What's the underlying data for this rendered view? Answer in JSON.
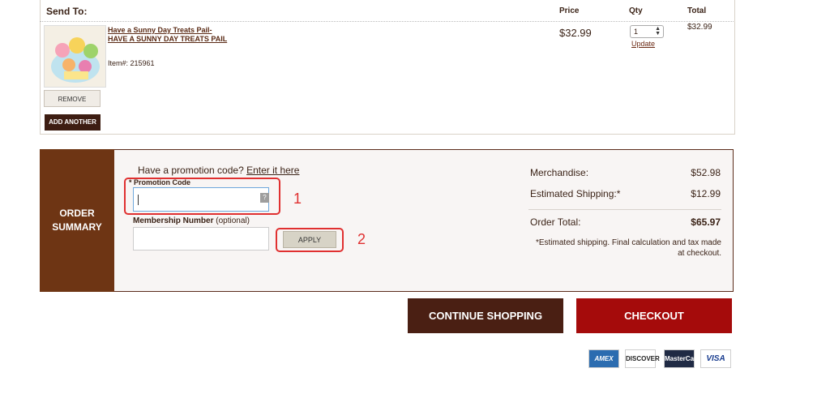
{
  "cart": {
    "send_to_label": "Send To:",
    "columns": {
      "price": "Price",
      "qty": "Qty",
      "total": "Total"
    },
    "item": {
      "name_line1": "Have a Sunny Day Treats Pail-",
      "name_line2": "HAVE A SUNNY DAY TREATS PAIL",
      "item_number": "Item#: 215961",
      "price": "$32.99",
      "qty": "1",
      "update_label": "Update",
      "total": "$32.99"
    },
    "remove_label": "REMOVE",
    "add_another_label": "ADD ANOTHER"
  },
  "summary": {
    "side_title_line1": "ORDER",
    "side_title_line2": "SUMMARY",
    "promo_question": "Have a promotion code?",
    "promo_link": "Enter it here",
    "promo_label": "* Promotion Code",
    "promo_help": "?",
    "membership_label": "Membership Number",
    "membership_optional": "(optional)",
    "apply_label": "APPLY",
    "annotation_1": "1",
    "annotation_2": "2",
    "merchandise_label": "Merchandise:",
    "merchandise_value": "$52.98",
    "shipping_label": "Estimated Shipping:*",
    "shipping_value": "$12.99",
    "order_total_label": "Order Total:",
    "order_total_value": "$65.97",
    "shipping_note": "*Estimated shipping. Final calculation and tax made at checkout."
  },
  "actions": {
    "continue_label": "CONTINUE SHOPPING",
    "checkout_label": "CHECKOUT"
  },
  "payment_cards": {
    "amex": "AMEX",
    "discover": "DISCOVER",
    "mastercard": "MasterCard",
    "visa": "VISA"
  },
  "colors": {
    "brand_brown": "#6e3514",
    "dark_brown": "#4a1f13",
    "checkout_red": "#a50b0b",
    "highlight_red": "#e03030"
  }
}
